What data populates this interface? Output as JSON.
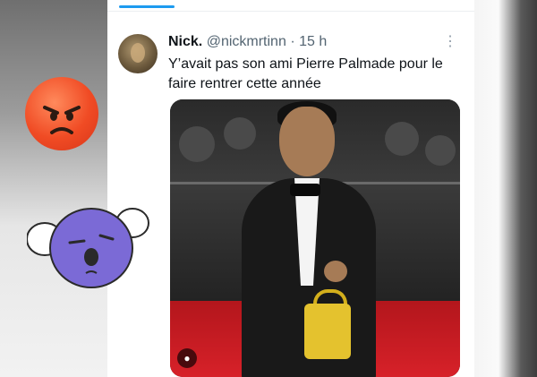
{
  "tweet": {
    "display_name": "Nick.",
    "handle": "@nickmrtinn",
    "separator": "·",
    "time": "15 h",
    "text": "Y’avait pas son ami Pierre Palmade pour le faire rentrer cette année",
    "more_icon": "⋮"
  },
  "media": {
    "watermark_icon": "●"
  },
  "stickers": {
    "angry_emoji": "angry-face",
    "koala": "koala-face"
  },
  "colors": {
    "accent": "#1d9bf0",
    "angry": "#f04b24",
    "koala": "#7b6ad6"
  }
}
